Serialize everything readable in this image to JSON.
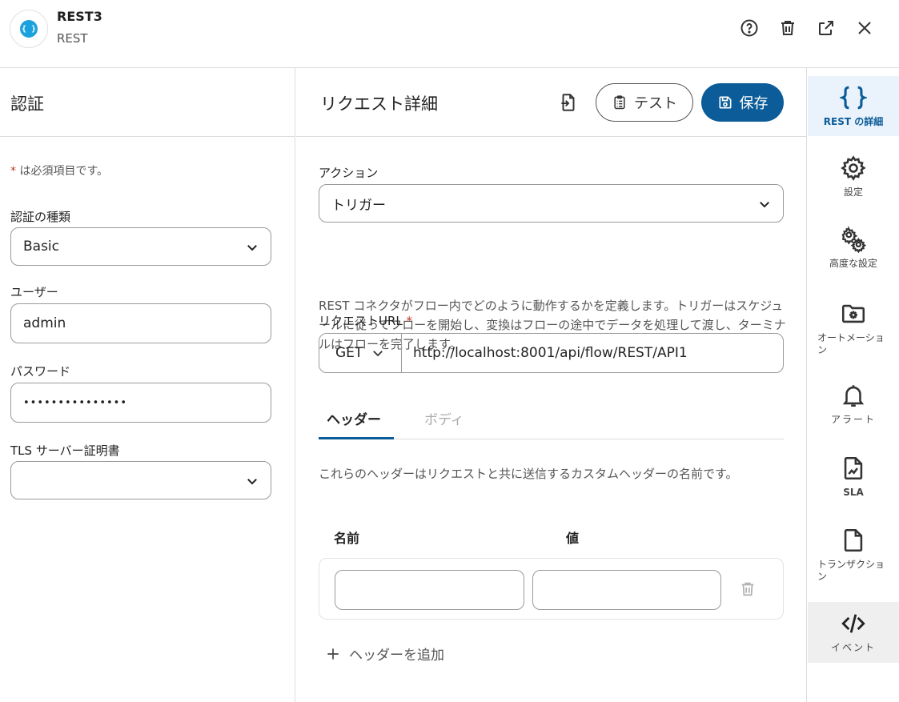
{
  "header": {
    "logo_glyph": "{ }",
    "title": "REST3",
    "subtitle": "REST",
    "icons": [
      "help-icon",
      "trash-icon",
      "open-external-icon",
      "close-icon"
    ]
  },
  "auth_panel": {
    "title": "認証",
    "required_star": "*",
    "required_note": " は必須項目です。",
    "auth_type_label": "認証の種類",
    "auth_type_value": "Basic",
    "user_label": "ユーザー",
    "user_value": "admin",
    "password_label": "パスワード",
    "password_value": "•••••••••••••••",
    "tls_label": "TLS サーバー証明書",
    "tls_value": ""
  },
  "request_panel": {
    "title": "リクエスト詳細",
    "test_label": "テスト",
    "save_label": "保存",
    "action_label": "アクション",
    "action_value": "トリガー",
    "action_description": "REST コネクタがフロー内でどのように動作するかを定義します。トリガーはスケジュールに従ってフローを開始し、変換はフローの途中でデータを処理して渡し、ターミナルはフローを完了します。",
    "url_label": "リクエストURL",
    "url_required_star": "*",
    "method": "GET",
    "url_value": "http://localhost:8001/api/flow/REST/API1",
    "tabs": [
      {
        "label": "ヘッダー",
        "active": true
      },
      {
        "label": "ボディ",
        "active": false
      }
    ],
    "headers_description": "これらのヘッダーはリクエストと共に送信するカスタムヘッダーの名前です。",
    "col_name": "名前",
    "col_value": "値",
    "header_rows": [
      {
        "name": "",
        "value": ""
      }
    ],
    "add_header_label": "ヘッダーを追加"
  },
  "rail": {
    "items": [
      {
        "label": "REST の詳細",
        "icon": "braces-icon",
        "active": true
      },
      {
        "label": "設定",
        "icon": "gear-icon",
        "active": false
      },
      {
        "label": "高度な設定",
        "icon": "gears-icon",
        "active": false
      },
      {
        "label": "オートメーション",
        "icon": "folder-gear-icon",
        "active": false
      },
      {
        "label": "アラート",
        "icon": "bell-icon",
        "active": false
      },
      {
        "label": "SLA",
        "icon": "chart-file-icon",
        "active": false
      },
      {
        "label": "トランザクション",
        "icon": "file-icon",
        "active": false
      },
      {
        "label": "イベント",
        "icon": "code-icon",
        "active": false
      }
    ]
  },
  "colors": {
    "primary": "#0b5c98",
    "logo": "#1ba1dd",
    "required": "#c0392b",
    "rail_active_bg": "#eaf3fb"
  }
}
